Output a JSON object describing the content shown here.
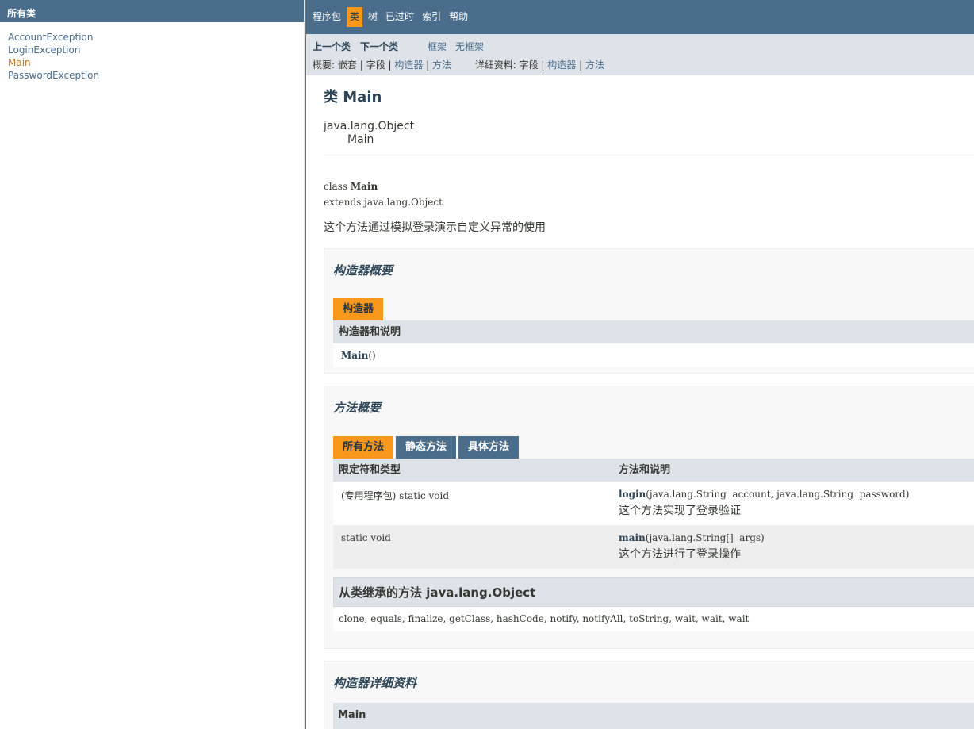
{
  "left_frame": {
    "header": "所有类",
    "classes": [
      {
        "label": "AccountException",
        "active": false
      },
      {
        "label": "LoginException",
        "active": false
      },
      {
        "label": "Main",
        "active": true
      },
      {
        "label": "PasswordException",
        "active": false
      }
    ]
  },
  "top_nav": {
    "items": [
      "程序包",
      "类",
      "树",
      "已过时",
      "索引",
      "帮助"
    ],
    "current": "类"
  },
  "sub_nav": {
    "prev_class": "上一个类",
    "next_class": "下一个类",
    "frames": "框架",
    "no_frames": "无框架",
    "summary_label": "概要:",
    "summary_nested": "嵌套",
    "summary_field": "字段",
    "summary_constructor": "构造器",
    "summary_method": "方法",
    "detail_label": "详细资料:",
    "detail_field": "字段",
    "detail_constructor": "构造器",
    "detail_method": "方法",
    "sep": "|"
  },
  "class_header": {
    "title": "类 Main",
    "super": "java.lang.Object",
    "child": "Main"
  },
  "signature": {
    "line1_prefix": "class ",
    "line1_name": "Main",
    "line2": "extends java.lang.Object"
  },
  "description": "这个方法通过模拟登录演示自定义异常的使用",
  "constructor_summary": {
    "title": "构造器概要",
    "tab": "构造器",
    "header": "构造器和说明",
    "rows": [
      {
        "name": "Main",
        "params": "()"
      }
    ]
  },
  "method_summary": {
    "title": "方法概要",
    "tabs": [
      {
        "label": "所有方法",
        "active": true
      },
      {
        "label": "静态方法",
        "active": false
      },
      {
        "label": "具体方法",
        "active": false
      }
    ],
    "header_modifier": "限定符和类型",
    "header_method": "方法和说明",
    "rows": [
      {
        "modifier": "(专用程序包) static void",
        "name": "login",
        "params": "(java.lang.String  account, java.lang.String  password)",
        "desc": "这个方法实现了登录验证"
      },
      {
        "modifier": "static void",
        "name": "main",
        "params": "(java.lang.String[]  args)",
        "desc": "这个方法进行了登录操作"
      }
    ],
    "inherited_title": "从类继承的方法 java.lang.Object",
    "inherited_methods": "clone, equals, finalize, getClass, hashCode, notify, notifyAll, toString, wait, wait, wait"
  },
  "constructor_detail": {
    "title": "构造器详细资料",
    "item": "Main"
  },
  "colors": {
    "nav_blue": "#4a6d8c",
    "sub_nav_bg": "#dee3e9",
    "accent_orange": "#f8981d",
    "link_blue": "#4a6d8c",
    "active_link": "#bb7a2a"
  }
}
